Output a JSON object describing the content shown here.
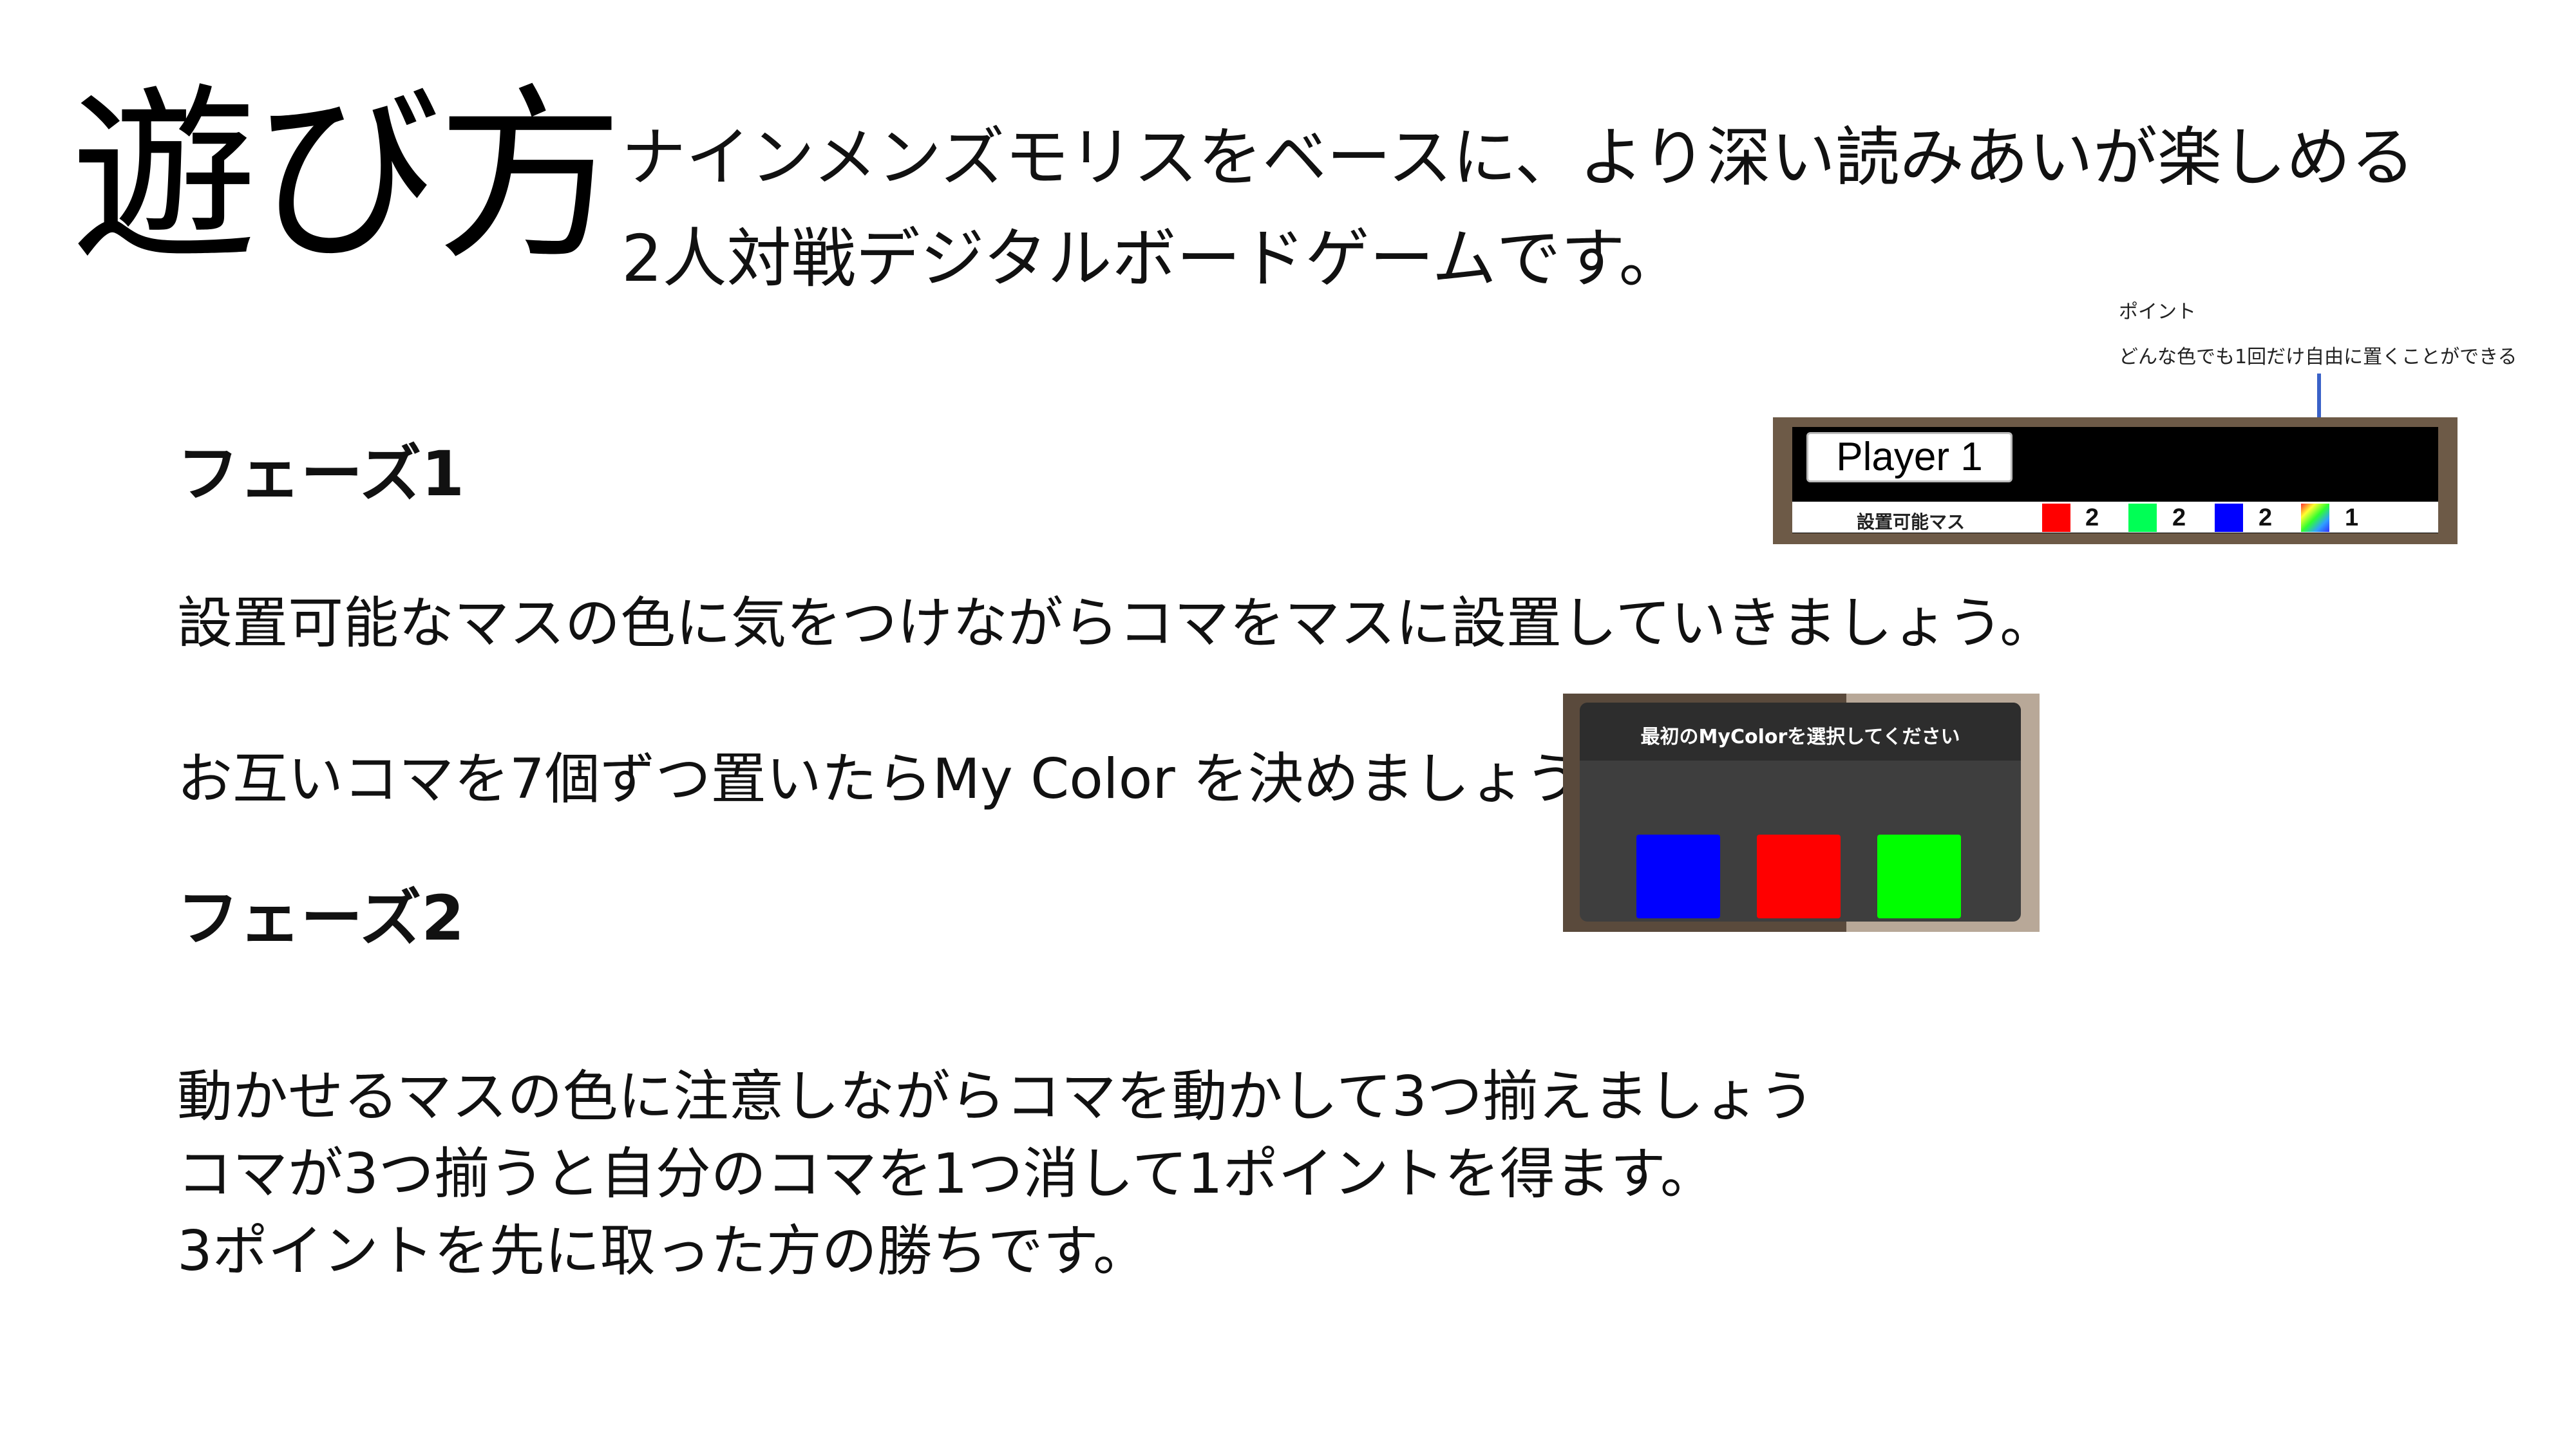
{
  "title": "遊び方",
  "intro": {
    "line1": "ナインメンズモリスをベースに、より深い読みあいが楽しめる",
    "line2": "2人対戦デジタルボードゲームです。"
  },
  "note": {
    "label": "ポイント",
    "text": "どんな色でも1回だけ自由に置くことができる"
  },
  "phase1": {
    "heading": "フェーズ1",
    "line1": "設置可能なマスの色に気をつけながらコマをマスに設置していきましょう。",
    "line2": "お互いコマを7個ずつ置いたらMy Color を決めましょう"
  },
  "phase2": {
    "heading": "フェーズ2",
    "line1": "動かせるマスの色に注意しながらコマを動かして3つ揃えましょう",
    "line2": "コマが3つ揃うと自分のコマを1つ消して1ポイントを得ます。",
    "line3": "3ポイントを先に取った方の勝ちです。"
  },
  "player_panel": {
    "player_label": "Player 1",
    "caption": "設置可能マス",
    "counts": [
      {
        "color": "#ff0000",
        "value": "2"
      },
      {
        "color": "#00ff55",
        "value": "2"
      },
      {
        "color": "#0000ff",
        "value": "2"
      },
      {
        "color": "rainbow",
        "value": "1"
      }
    ]
  },
  "color_select": {
    "title": "最初のMyColorを選択してください",
    "options": [
      {
        "name": "blue",
        "color": "#0000ff"
      },
      {
        "name": "red",
        "color": "#ff0000"
      },
      {
        "name": "green",
        "color": "#00ff00"
      }
    ]
  }
}
